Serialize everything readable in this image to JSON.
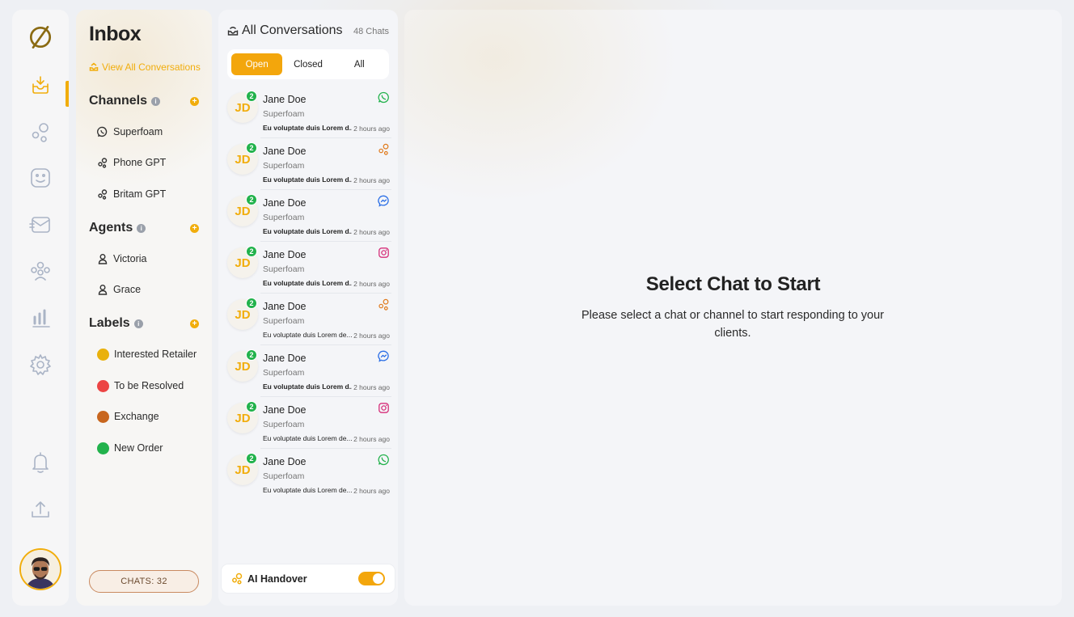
{
  "rail": {
    "items": [
      {
        "name": "logo-icon"
      },
      {
        "name": "inbox-icon",
        "active": true
      },
      {
        "name": "channels-icon"
      },
      {
        "name": "emoji-icon"
      },
      {
        "name": "broadcast-icon"
      },
      {
        "name": "team-icon"
      },
      {
        "name": "analytics-icon"
      },
      {
        "name": "settings-icon"
      },
      {
        "name": "bell-icon"
      },
      {
        "name": "upload-icon"
      }
    ]
  },
  "inbox": {
    "title": "Inbox",
    "view_all": "View All Conversations",
    "channels": {
      "title": "Channels",
      "items": [
        {
          "label": "Superfoam",
          "icon": "whatsapp-icon"
        },
        {
          "label": "Phone GPT",
          "icon": "gpt-icon"
        },
        {
          "label": "Britam GPT",
          "icon": "gpt-icon"
        }
      ]
    },
    "agents": {
      "title": "Agents",
      "items": [
        {
          "label": "Victoria",
          "icon": "user-icon"
        },
        {
          "label": "Grace",
          "icon": "user-icon"
        }
      ]
    },
    "labels": {
      "title": "Labels",
      "items": [
        {
          "label": "Interested Retailer",
          "color": "#e9b10c"
        },
        {
          "label": "To be Resolved",
          "color": "#ec4444"
        },
        {
          "label": "Exchange",
          "color": "#c8661e"
        },
        {
          "label": "New Order",
          "color": "#22b24c"
        }
      ]
    },
    "chats_count": "CHATS: 32"
  },
  "conversations": {
    "title": "All Conversations",
    "count": "48 Chats",
    "filters": [
      "Open",
      "Closed",
      "All"
    ],
    "active_filter": "Open",
    "items": [
      {
        "initials": "JD",
        "badge": "2",
        "name": "Jane Doe",
        "sub": "Superfoam",
        "message": "Eu voluptate duis Lorem d...",
        "time": "2 hours ago",
        "channel": "whatsapp-icon",
        "bold": true
      },
      {
        "initials": "JD",
        "badge": "2",
        "name": "Jane Doe",
        "sub": "Superfoam",
        "message": "Eu voluptate duis Lorem d...",
        "time": "2 hours ago",
        "channel": "gpt-icon",
        "bold": true
      },
      {
        "initials": "JD",
        "badge": "2",
        "name": "Jane Doe",
        "sub": "Superfoam",
        "message": "Eu voluptate duis Lorem d...",
        "time": "2 hours ago",
        "channel": "messenger-icon",
        "bold": true
      },
      {
        "initials": "JD",
        "badge": "2",
        "name": "Jane Doe",
        "sub": "Superfoam",
        "message": "Eu voluptate duis Lorem d...",
        "time": "2 hours ago",
        "channel": "instagram-icon",
        "bold": true
      },
      {
        "initials": "JD",
        "badge": "2",
        "name": "Jane Doe",
        "sub": "Superfoam",
        "message": "Eu voluptate duis Lorem de...",
        "time": "2 hours ago",
        "channel": "gpt-icon",
        "bold": false
      },
      {
        "initials": "JD",
        "badge": "2",
        "name": "Jane Doe",
        "sub": "Superfoam",
        "message": "Eu voluptate duis Lorem d...",
        "time": "2 hours ago",
        "channel": "messenger-icon",
        "bold": true
      },
      {
        "initials": "JD",
        "badge": "2",
        "name": "Jane Doe",
        "sub": "Superfoam",
        "message": "Eu voluptate duis Lorem de...",
        "time": "2 hours ago",
        "channel": "instagram-icon",
        "bold": false
      },
      {
        "initials": "JD",
        "badge": "2",
        "name": "Jane Doe",
        "sub": "Superfoam",
        "message": "Eu voluptate duis Lorem de...",
        "time": "2 hours ago",
        "channel": "whatsapp-icon",
        "bold": false
      }
    ],
    "ai_handover": {
      "label": "AI Handover",
      "enabled": true
    }
  },
  "main": {
    "title": "Select Chat to Start",
    "subtitle": "Please select a chat or channel to start responding to your clients."
  },
  "colors": {
    "accent": "#f1ad0c",
    "online": "#22b24c"
  }
}
